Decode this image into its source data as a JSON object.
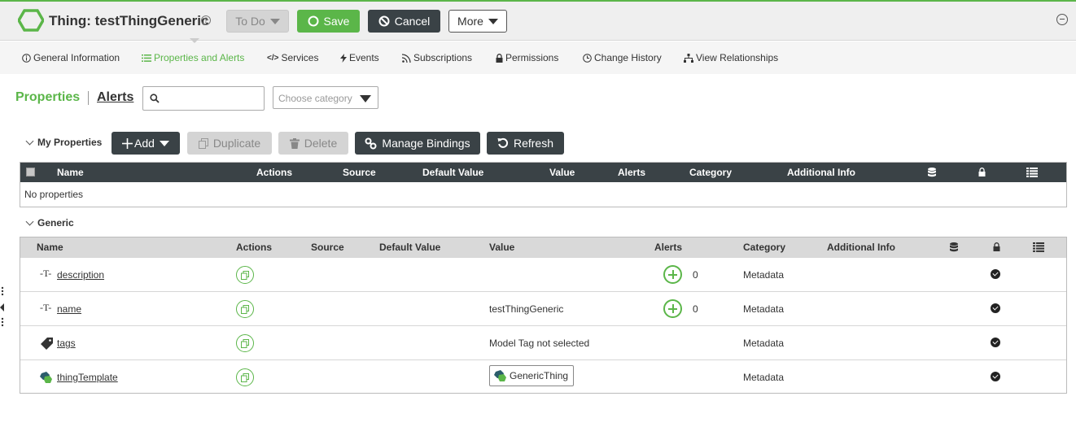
{
  "header": {
    "title": "Thing: testThingGeneric",
    "state_label": "To Do",
    "save_label": "Save",
    "cancel_label": "Cancel",
    "more_label": "More"
  },
  "nav": {
    "tabs": [
      {
        "label": "General Information",
        "icon": "info-icon"
      },
      {
        "label": "Properties and Alerts",
        "icon": "list-icon",
        "active": true
      },
      {
        "label": "Services",
        "icon": "code-icon"
      },
      {
        "label": "Events",
        "icon": "lightning-icon"
      },
      {
        "label": "Subscriptions",
        "icon": "rss-icon"
      },
      {
        "label": "Permissions",
        "icon": "lock-icon"
      },
      {
        "label": "Change History",
        "icon": "clock-icon"
      },
      {
        "label": "View Relationships",
        "icon": "hierarchy-icon"
      }
    ]
  },
  "subnav": {
    "properties_label": "Properties",
    "alerts_label": "Alerts",
    "search_value": "",
    "category_placeholder": "Choose category"
  },
  "my_properties": {
    "label": "My Properties",
    "add_label": "Add",
    "duplicate_label": "Duplicate",
    "delete_label": "Delete",
    "manage_bindings_label": "Manage Bindings",
    "refresh_label": "Refresh",
    "columns": [
      "Name",
      "Actions",
      "Source",
      "Default Value",
      "Value",
      "Alerts",
      "Category",
      "Additional Info"
    ],
    "empty_text": "No properties"
  },
  "generic": {
    "label": "Generic",
    "columns": [
      "Name",
      "Actions",
      "Source",
      "Default Value",
      "Value",
      "Alerts",
      "Category",
      "Additional Info"
    ],
    "rows": [
      {
        "name": "description",
        "icon": "text-type-icon",
        "value": "",
        "alerts": "0",
        "category": "Metadata"
      },
      {
        "name": "name",
        "icon": "text-type-icon",
        "value": "testThingGeneric",
        "alerts": "0",
        "category": "Metadata"
      },
      {
        "name": "tags",
        "icon": "tag-icon",
        "value": "Model Tag not selected",
        "alerts": "",
        "category": "Metadata"
      },
      {
        "name": "thingTemplate",
        "icon": "thing-template-icon",
        "value": "GenericThing",
        "alerts": "",
        "category": "Metadata"
      }
    ]
  },
  "colors": {
    "accent": "#5bb649",
    "dark": "#3a4246"
  }
}
